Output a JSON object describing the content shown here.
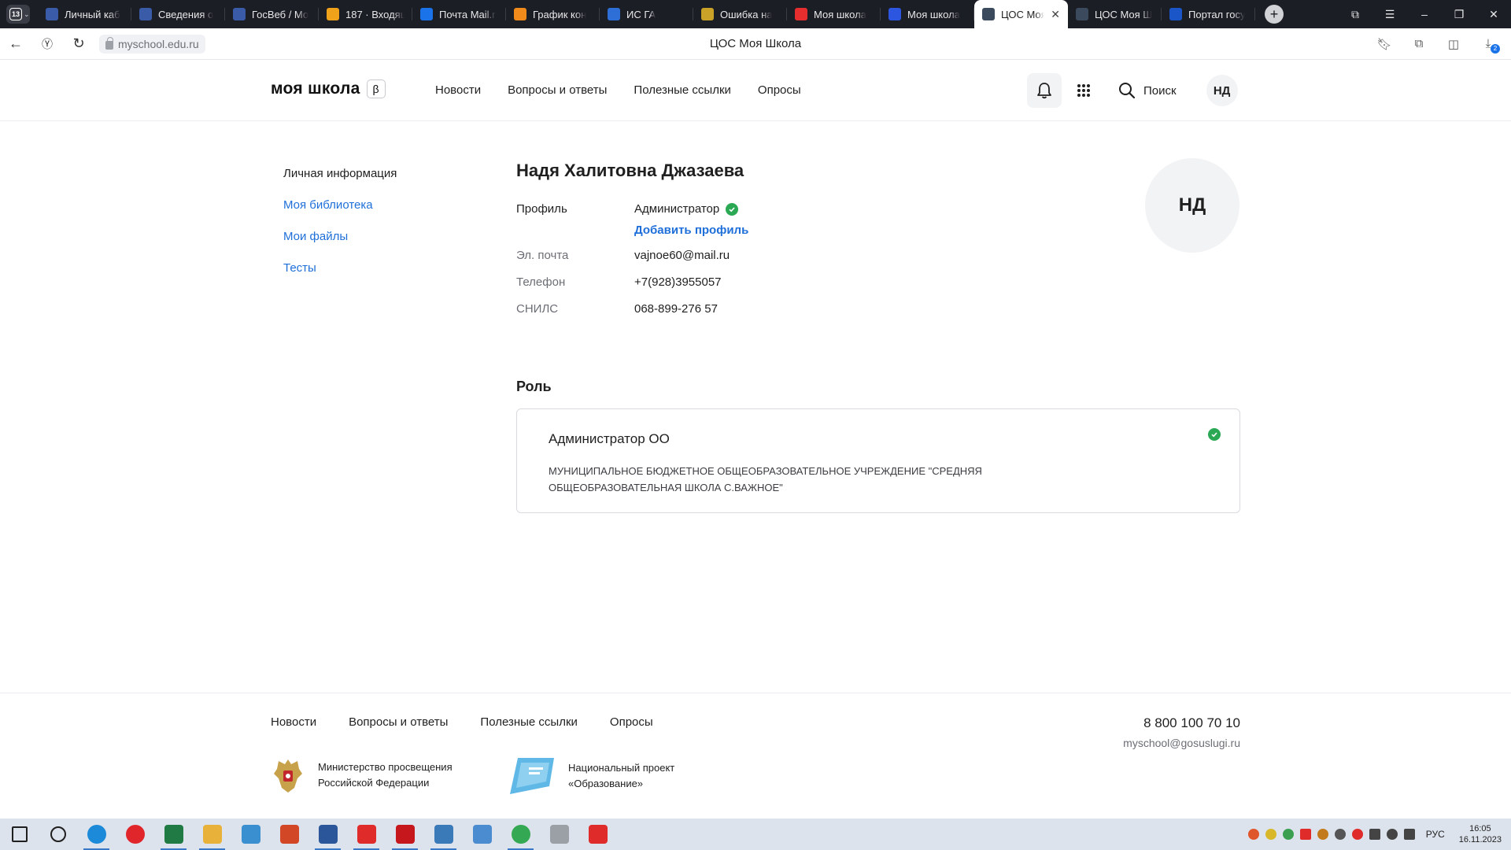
{
  "browser": {
    "tab_count": "13",
    "tabs": [
      {
        "title": "Личный каб",
        "icon": "emblem-icon",
        "color": "#3a5ba8"
      },
      {
        "title": "Сведения о",
        "icon": "emblem-icon",
        "color": "#3a5ba8"
      },
      {
        "title": "ГосВеб / Мо",
        "icon": "emblem-icon",
        "color": "#3a5ba8"
      },
      {
        "title": "187 · Входящ",
        "icon": "mail-envelope-icon",
        "color": "#f0a21b"
      },
      {
        "title": "Почта Mail.r",
        "icon": "mail-icon",
        "color": "#1a73e8"
      },
      {
        "title": "График кон",
        "icon": "cloud-icon",
        "color": "#f08a1b"
      },
      {
        "title": "ИС ГА",
        "icon": "shield-icon",
        "color": "#2d6fd6"
      },
      {
        "title": "Ошибка на",
        "icon": "hand-icon",
        "color": "#c9a227"
      },
      {
        "title": "Моя школа",
        "icon": "yandex-icon",
        "color": "#e62e2e"
      },
      {
        "title": "Моя школа",
        "icon": "mш-icon",
        "color": "#2d56e0"
      },
      {
        "title": "ЦОС Моя",
        "icon": "atom-icon",
        "color": "#3b4a5c",
        "active": true
      },
      {
        "title": "ЦОС Моя Ш",
        "icon": "atom-icon",
        "color": "#3b4a5c"
      },
      {
        "title": "Портал госу",
        "icon": "flag-icon",
        "color": "#1a56c8"
      }
    ],
    "url": "myschool.edu.ru",
    "page_title": "ЦОС Моя Школа",
    "downloads_badge": "2"
  },
  "header": {
    "logo": "моя школа",
    "beta": "β",
    "nav": [
      "Новости",
      "Вопросы и ответы",
      "Полезные ссылки",
      "Опросы"
    ],
    "search_label": "Поиск",
    "avatar_initials": "НД"
  },
  "sidebar": {
    "items": [
      {
        "label": "Личная информация",
        "current": true
      },
      {
        "label": "Моя библиотека"
      },
      {
        "label": "Мои файлы"
      },
      {
        "label": "Тесты"
      }
    ]
  },
  "profile": {
    "full_name": "Надя Халитовна Джазаева",
    "profile_label": "Профиль",
    "profile_value": "Администратор",
    "add_profile": "Добавить профиль",
    "email_label": "Эл. почта",
    "email_value": "vajnoe60@mail.ru",
    "phone_label": "Телефон",
    "phone_value": "+7(928)3955057",
    "snils_label": "СНИЛС",
    "snils_value": "068-899-276 57",
    "avatar_initials": "НД"
  },
  "role": {
    "title": "Роль",
    "name": "Администратор ОО",
    "organization": "МУНИЦИПАЛЬНОЕ БЮДЖЕТНОЕ ОБЩЕОБРАЗОВАТЕЛЬНОЕ УЧРЕЖДЕНИЕ \"СРЕДНЯЯ ОБЩЕОБРАЗОВАТЕЛЬНАЯ ШКОЛА С.ВАЖНОЕ\""
  },
  "footer": {
    "nav": [
      "Новости",
      "Вопросы и ответы",
      "Полезные ссылки",
      "Опросы"
    ],
    "phone": "8 800 100 70 10",
    "email": "myschool@gosuslugi.ru",
    "ministry_line1": "Министерство просвещения",
    "ministry_line2": "Российской Федерации",
    "project_line1": "Национальный проект",
    "project_line2": "«Образование»"
  },
  "taskbar": {
    "apps": [
      {
        "icon": "start-icon",
        "color": "#1f1f1f"
      },
      {
        "icon": "search-icon",
        "color": "#1f1f1f"
      },
      {
        "icon": "edge-icon",
        "color": "#1c8ad8"
      },
      {
        "icon": "opera-icon",
        "color": "#e0262b"
      },
      {
        "icon": "excel-icon",
        "color": "#1f7a43"
      },
      {
        "icon": "explorer-icon",
        "color": "#e8b23a"
      },
      {
        "icon": "app-icon",
        "color": "#3a8fd0"
      },
      {
        "icon": "powerpoint-icon",
        "color": "#d24726"
      },
      {
        "icon": "word-icon",
        "color": "#2b579a"
      },
      {
        "icon": "yandex-browser-icon",
        "color": "#e02b2b"
      },
      {
        "icon": "acrobat-icon",
        "color": "#c5171c"
      },
      {
        "icon": "boat-icon",
        "color": "#3a7ab8"
      },
      {
        "icon": "image-viewer-icon",
        "color": "#4a8ccf"
      },
      {
        "icon": "chrome-icon",
        "color": "#34a853"
      },
      {
        "icon": "document-icon",
        "color": "#9aa0a6"
      },
      {
        "icon": "channel-5-icon",
        "color": "#e02b2b"
      }
    ],
    "lang": "РУС",
    "time": "16:05",
    "date": "16.11.2023"
  }
}
